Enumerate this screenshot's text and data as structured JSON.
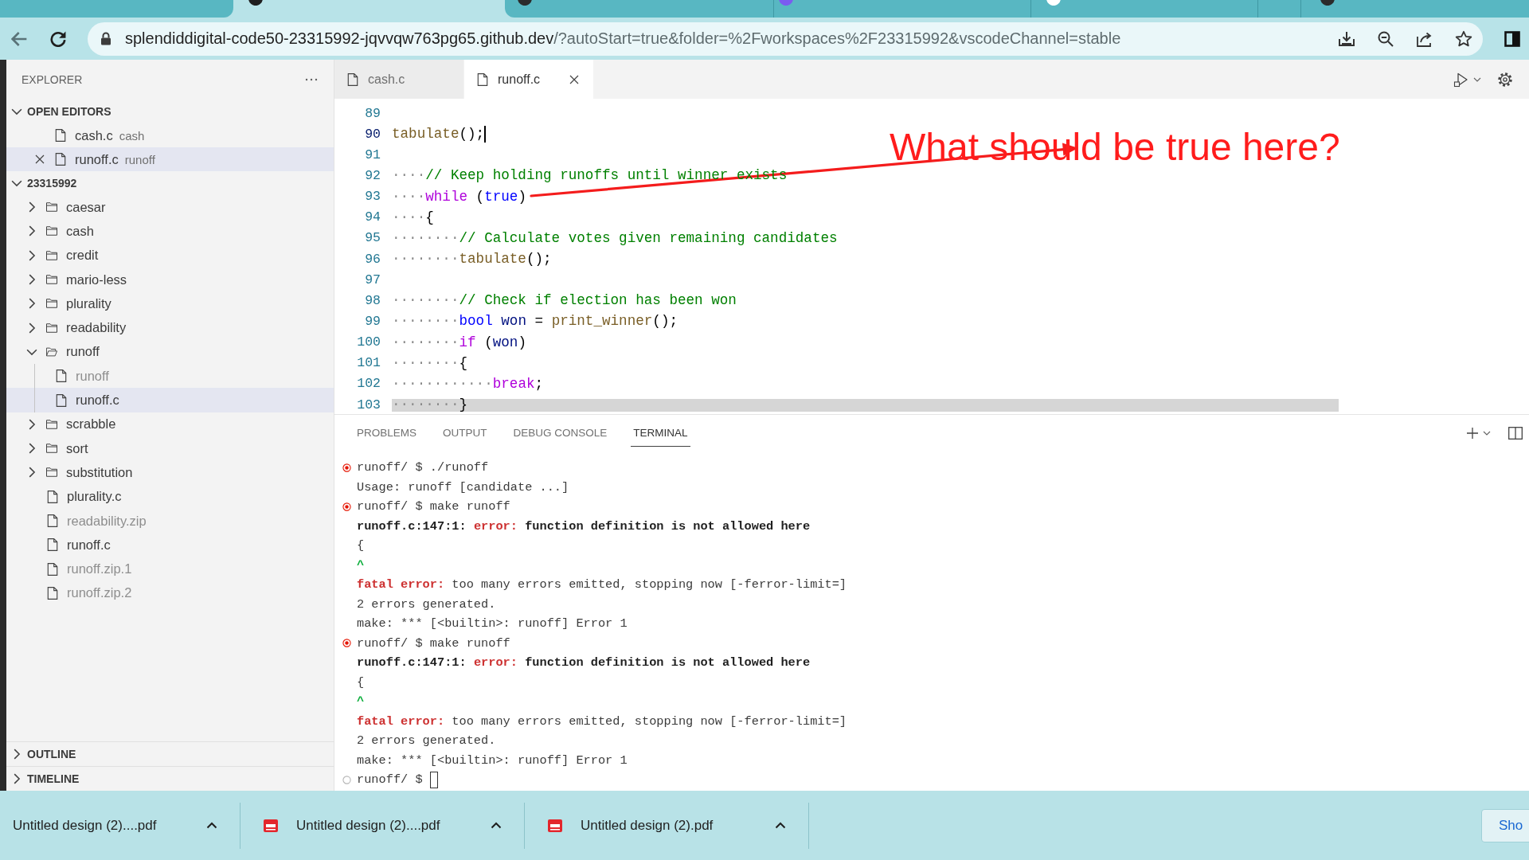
{
  "browser": {
    "tabs": [
      {
        "selected": false
      },
      {
        "selected": true,
        "color": "#1f1f1f"
      },
      {
        "selected": false,
        "color": "#2b2b2b"
      },
      {
        "selected": false,
        "color": "#7b5cf0"
      },
      {
        "selected": false,
        "color": "#ffffff"
      },
      {
        "selected": false
      },
      {
        "selected": false,
        "color": "#2b2b2b"
      }
    ],
    "address": {
      "host": "splendiddigital-code50-23315992-jqvvqw763pg65.github.dev",
      "path": "/?autoStart=true&folder=%2Fworkspaces%2F23315992&vscodeChannel=stable"
    }
  },
  "explorer": {
    "title": "EXPLORER",
    "open_editors": {
      "title": "OPEN EDITORS",
      "expanded": true,
      "items": [
        {
          "label": "cash.c",
          "description": "cash",
          "selected": false
        },
        {
          "label": "runoff.c",
          "description": "runoff",
          "selected": true
        }
      ]
    },
    "workspace": {
      "title": "23315992",
      "expanded": true,
      "items": [
        {
          "label": "caesar",
          "kind": "folder",
          "expanded": false,
          "selected": false,
          "dimmed": false
        },
        {
          "label": "cash",
          "kind": "folder",
          "expanded": false,
          "selected": false,
          "dimmed": false
        },
        {
          "label": "credit",
          "kind": "folder",
          "expanded": false,
          "selected": false,
          "dimmed": false
        },
        {
          "label": "mario-less",
          "kind": "folder",
          "expanded": false,
          "selected": false,
          "dimmed": false
        },
        {
          "label": "plurality",
          "kind": "folder",
          "expanded": false,
          "selected": false,
          "dimmed": false
        },
        {
          "label": "readability",
          "kind": "folder",
          "expanded": false,
          "selected": false,
          "dimmed": false
        },
        {
          "label": "runoff",
          "kind": "folder",
          "expanded": true,
          "selected": false,
          "dimmed": false,
          "children": [
            {
              "label": "runoff",
              "kind": "file",
              "selected": false,
              "dimmed": true
            },
            {
              "label": "runoff.c",
              "kind": "file",
              "selected": true,
              "dimmed": false
            }
          ]
        },
        {
          "label": "scrabble",
          "kind": "folder",
          "expanded": false,
          "selected": false,
          "dimmed": false
        },
        {
          "label": "sort",
          "kind": "folder",
          "expanded": false,
          "selected": false,
          "dimmed": false
        },
        {
          "label": "substitution",
          "kind": "folder",
          "expanded": false,
          "selected": false,
          "dimmed": false
        },
        {
          "label": "plurality.c",
          "kind": "file",
          "selected": false,
          "dimmed": false
        },
        {
          "label": "readability.zip",
          "kind": "file",
          "selected": false,
          "dimmed": true
        },
        {
          "label": "runoff.c",
          "kind": "file",
          "selected": false,
          "dimmed": false
        },
        {
          "label": "runoff.zip.1",
          "kind": "file",
          "selected": false,
          "dimmed": true
        },
        {
          "label": "runoff.zip.2",
          "kind": "file",
          "selected": false,
          "dimmed": true
        }
      ]
    },
    "outline": {
      "title": "OUTLINE",
      "expanded": false
    },
    "timeline": {
      "title": "TIMELINE",
      "expanded": false
    }
  },
  "editor_tabs": [
    {
      "label": "cash.c",
      "selected": false
    },
    {
      "label": "runoff.c",
      "selected": true
    }
  ],
  "editor": {
    "lines": [
      {
        "number": "89",
        "cursor": false
      },
      {
        "number": "90",
        "cursor": true,
        "tokens": [
          {
            "text": "tabulate",
            "kind": "function"
          },
          {
            "text": "();",
            "kind": "plain"
          }
        ]
      },
      {
        "number": "91",
        "cursor": false
      },
      {
        "number": "92",
        "cursor": false,
        "tokens": [
          {
            "text": "····",
            "kind": "whitespace"
          },
          {
            "text": "// Keep holding runoffs until winner exists",
            "kind": "comment"
          }
        ]
      },
      {
        "number": "93",
        "cursor": false,
        "tokens": [
          {
            "text": "····",
            "kind": "whitespace"
          },
          {
            "text": "while",
            "kind": "keyword"
          },
          {
            "text": " (",
            "kind": "plain"
          },
          {
            "text": "true",
            "kind": "constant"
          },
          {
            "text": ")",
            "kind": "plain"
          }
        ]
      },
      {
        "number": "94",
        "cursor": false,
        "tokens": [
          {
            "text": "····",
            "kind": "whitespace"
          },
          {
            "text": "{",
            "kind": "plain"
          }
        ]
      },
      {
        "number": "95",
        "cursor": false,
        "tokens": [
          {
            "text": "········",
            "kind": "whitespace"
          },
          {
            "text": "// Calculate votes given remaining candidates",
            "kind": "comment"
          }
        ]
      },
      {
        "number": "96",
        "cursor": false,
        "tokens": [
          {
            "text": "········",
            "kind": "whitespace"
          },
          {
            "text": "tabulate",
            "kind": "function"
          },
          {
            "text": "();",
            "kind": "plain"
          }
        ]
      },
      {
        "number": "97",
        "cursor": false
      },
      {
        "number": "98",
        "cursor": false,
        "tokens": [
          {
            "text": "········",
            "kind": "whitespace"
          },
          {
            "text": "// Check if election has been won",
            "kind": "comment"
          }
        ]
      },
      {
        "number": "99",
        "cursor": false,
        "tokens": [
          {
            "text": "········",
            "kind": "whitespace"
          },
          {
            "text": "bool",
            "kind": "type"
          },
          {
            "text": " won",
            "kind": "variable"
          },
          {
            "text": " = ",
            "kind": "plain"
          },
          {
            "text": "print_winner",
            "kind": "function"
          },
          {
            "text": "();",
            "kind": "plain"
          }
        ]
      },
      {
        "number": "100",
        "cursor": false,
        "tokens": [
          {
            "text": "········",
            "kind": "whitespace"
          },
          {
            "text": "if",
            "kind": "keyword"
          },
          {
            "text": " (",
            "kind": "plain"
          },
          {
            "text": "won",
            "kind": "variable"
          },
          {
            "text": ")",
            "kind": "plain"
          }
        ]
      },
      {
        "number": "101",
        "cursor": false,
        "tokens": [
          {
            "text": "········",
            "kind": "whitespace"
          },
          {
            "text": "{",
            "kind": "plain"
          }
        ]
      },
      {
        "number": "102",
        "cursor": false,
        "tokens": [
          {
            "text": "············",
            "kind": "whitespace"
          },
          {
            "text": "break",
            "kind": "keyword"
          },
          {
            "text": ";",
            "kind": "plain"
          }
        ]
      },
      {
        "number": "103",
        "cursor": false,
        "tokens": [
          {
            "text": "········",
            "kind": "whitespace"
          },
          {
            "text": "}",
            "kind": "plain"
          }
        ]
      }
    ]
  },
  "annotation": {
    "text": "What should be true here?"
  },
  "panel": {
    "tabs": [
      {
        "label": "PROBLEMS",
        "selected": false
      },
      {
        "label": "OUTPUT",
        "selected": false
      },
      {
        "label": "DEBUG CONSOLE",
        "selected": false
      },
      {
        "label": "TERMINAL",
        "selected": true
      }
    ],
    "terminal": {
      "cursor": true,
      "lines": [
        {
          "kind": "failed",
          "segments": [
            {
              "text": "runoff/ $ ./runoff",
              "kind": "plain"
            }
          ]
        },
        {
          "kind": "output",
          "segments": [
            {
              "text": "Usage: runoff [candidate ...]",
              "kind": "plain"
            }
          ]
        },
        {
          "kind": "failed",
          "segments": [
            {
              "text": "runoff/ $ make runoff",
              "kind": "plain"
            }
          ]
        },
        {
          "kind": "output",
          "segments": [
            {
              "text": "runoff.c:147:1: ",
              "kind": "bold"
            },
            {
              "text": "error:",
              "kind": "error"
            },
            {
              "text": " function definition is not allowed here",
              "kind": "bold"
            }
          ]
        },
        {
          "kind": "output",
          "segments": [
            {
              "text": "{",
              "kind": "plain"
            }
          ]
        },
        {
          "kind": "output",
          "segments": [
            {
              "text": "^",
              "kind": "caret"
            }
          ]
        },
        {
          "kind": "output",
          "segments": [
            {
              "text": "fatal error:",
              "kind": "error"
            },
            {
              "text": " too many errors emitted, stopping now [-ferror-limit=]",
              "kind": "plain"
            }
          ]
        },
        {
          "kind": "output",
          "segments": [
            {
              "text": "2 errors generated.",
              "kind": "plain"
            }
          ]
        },
        {
          "kind": "output",
          "segments": [
            {
              "text": "make: *** [<builtin>: runoff] Error 1",
              "kind": "plain"
            }
          ]
        },
        {
          "kind": "failed",
          "segments": [
            {
              "text": "runoff/ $ make runoff",
              "kind": "plain"
            }
          ]
        },
        {
          "kind": "output",
          "segments": [
            {
              "text": "runoff.c:147:1: ",
              "kind": "bold"
            },
            {
              "text": "error:",
              "kind": "error"
            },
            {
              "text": " function definition is not allowed here",
              "kind": "bold"
            }
          ]
        },
        {
          "kind": "output",
          "segments": [
            {
              "text": "{",
              "kind": "plain"
            }
          ]
        },
        {
          "kind": "output",
          "segments": [
            {
              "text": "^",
              "kind": "caret"
            }
          ]
        },
        {
          "kind": "output",
          "segments": [
            {
              "text": "fatal error:",
              "kind": "error"
            },
            {
              "text": " too many errors emitted, stopping now [-ferror-limit=]",
              "kind": "plain"
            }
          ]
        },
        {
          "kind": "output",
          "segments": [
            {
              "text": "2 errors generated.",
              "kind": "plain"
            }
          ]
        },
        {
          "kind": "output",
          "segments": [
            {
              "text": "make: *** [<builtin>: runoff] Error 1",
              "kind": "plain"
            }
          ]
        },
        {
          "kind": "pending",
          "segments": [
            {
              "text": "runoff/ $",
              "kind": "plain"
            }
          ]
        }
      ]
    }
  },
  "downloads": {
    "items": [
      {
        "name": "Untitled design (2)....pdf",
        "pdf_icon": false
      },
      {
        "name": "Untitled design (2)....pdf",
        "pdf_icon": true
      },
      {
        "name": "Untitled design (2).pdf",
        "pdf_icon": true
      }
    ],
    "show_button": "Sho"
  }
}
